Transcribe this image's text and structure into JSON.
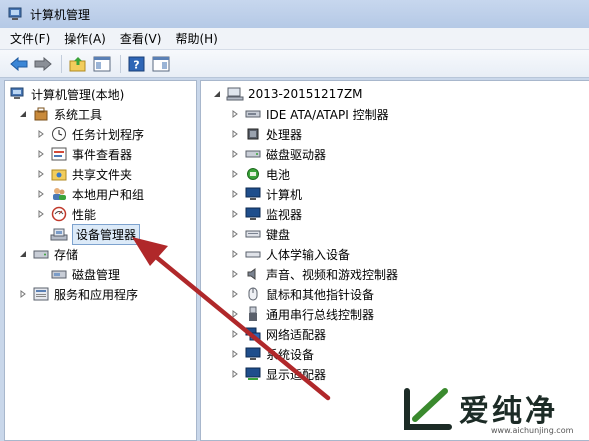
{
  "window": {
    "title": "计算机管理"
  },
  "menu": [
    "文件(F)",
    "操作(A)",
    "查看(V)",
    "帮助(H)"
  ],
  "left_tree": {
    "root": "计算机管理(本地)",
    "system_tools": "系统工具",
    "task_scheduler": "任务计划程序",
    "event_viewer": "事件查看器",
    "shared_folders": "共享文件夹",
    "local_users": "本地用户和组",
    "performance": "性能",
    "device_manager": "设备管理器",
    "storage": "存储",
    "disk_management": "磁盘管理",
    "services": "服务和应用程序"
  },
  "device_tree": {
    "computer_name": "2013-20151217ZM",
    "categories": [
      "IDE ATA/ATAPI 控制器",
      "处理器",
      "磁盘驱动器",
      "电池",
      "计算机",
      "监视器",
      "键盘",
      "人体学输入设备",
      "声音、视频和游戏控制器",
      "鼠标和其他指针设备",
      "通用串行总线控制器",
      "网络适配器",
      "系统设备",
      "显示适配器"
    ]
  },
  "watermark": {
    "text": "爱纯净",
    "url": "www.aichunjing.com"
  },
  "colors": {
    "arrow": "#b0282a",
    "selection": "#dceaf8",
    "watermark_green": "#3a8a2e"
  },
  "icons": {
    "toolbar": [
      "back-icon",
      "forward-icon",
      "up-folder-icon",
      "show-hide-tree-icon",
      "help-icon",
      "properties-icon"
    ]
  }
}
